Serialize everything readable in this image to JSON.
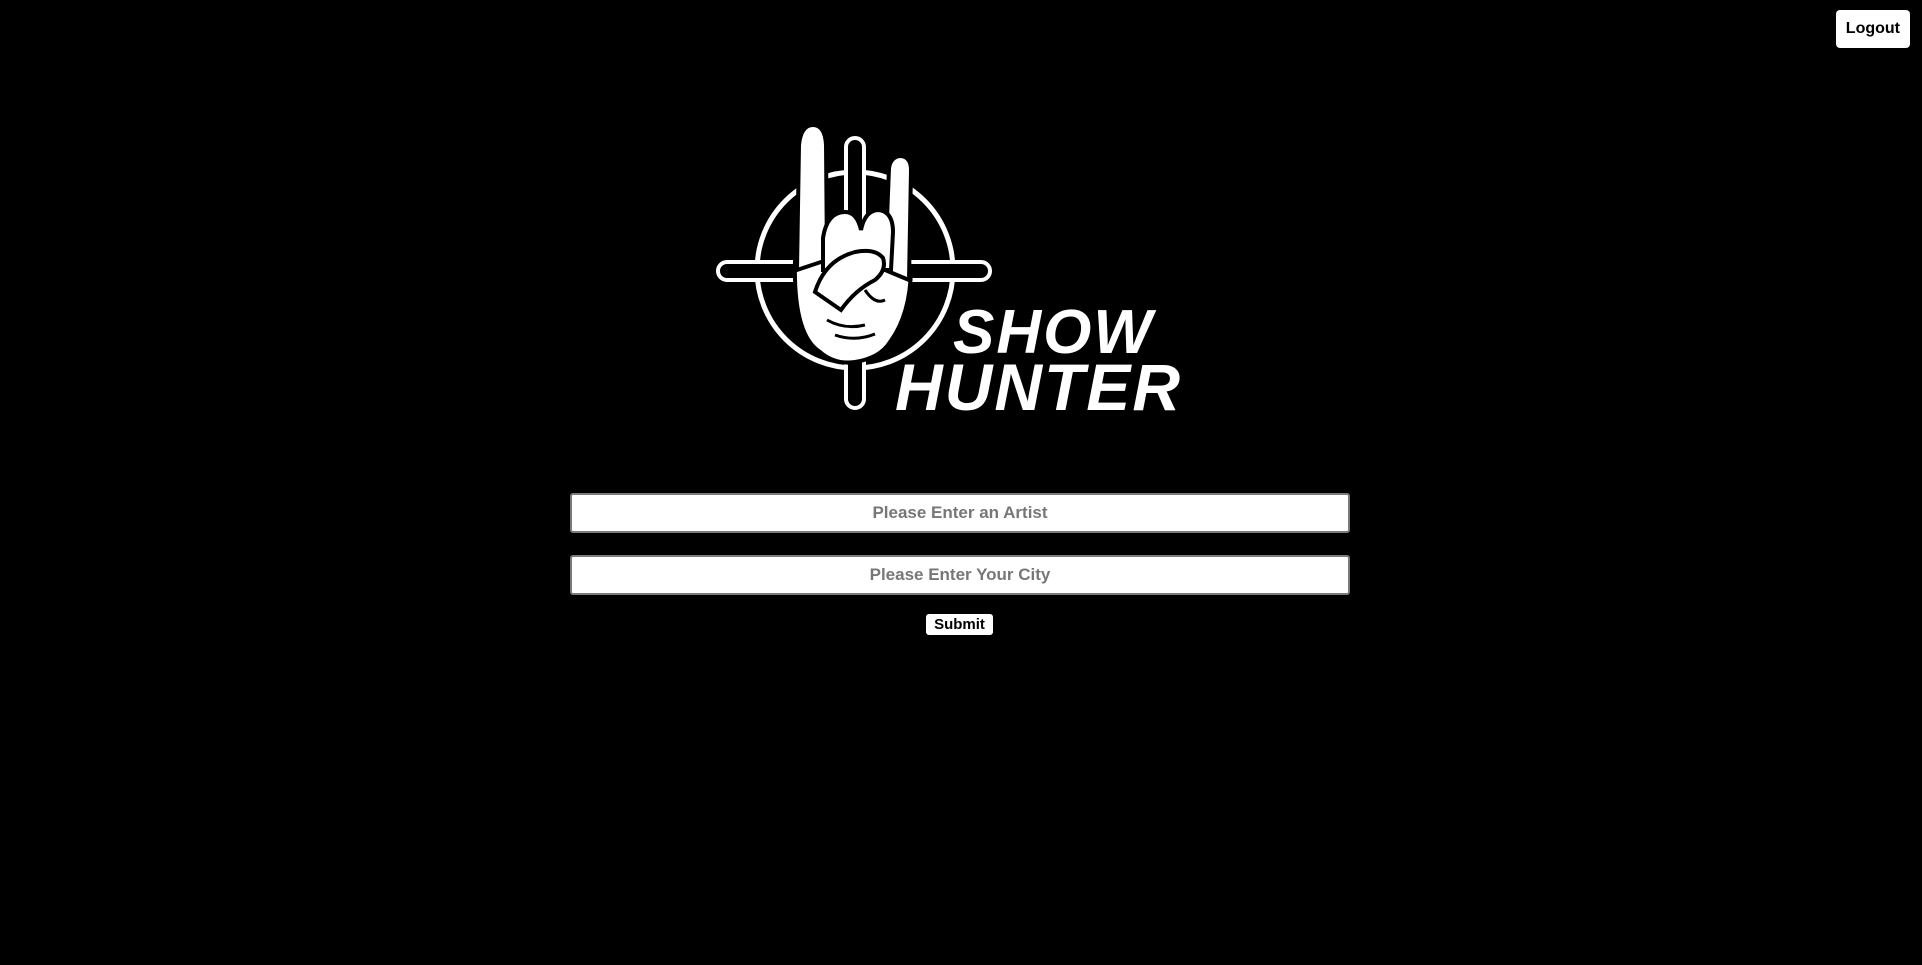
{
  "header": {
    "logout_label": "Logout"
  },
  "logo": {
    "name": "show-hunter-logo",
    "wordmark_line1": "SHOW",
    "wordmark_line2": "HUNTER",
    "icon": "horns-hand-crosshair-icon"
  },
  "search": {
    "artist_placeholder": "Please Enter an Artist",
    "artist_value": "",
    "city_placeholder": "Please Enter Your City",
    "city_value": "",
    "submit_label": "Submit"
  },
  "colors": {
    "background": "#000000",
    "foreground": "#ffffff"
  }
}
